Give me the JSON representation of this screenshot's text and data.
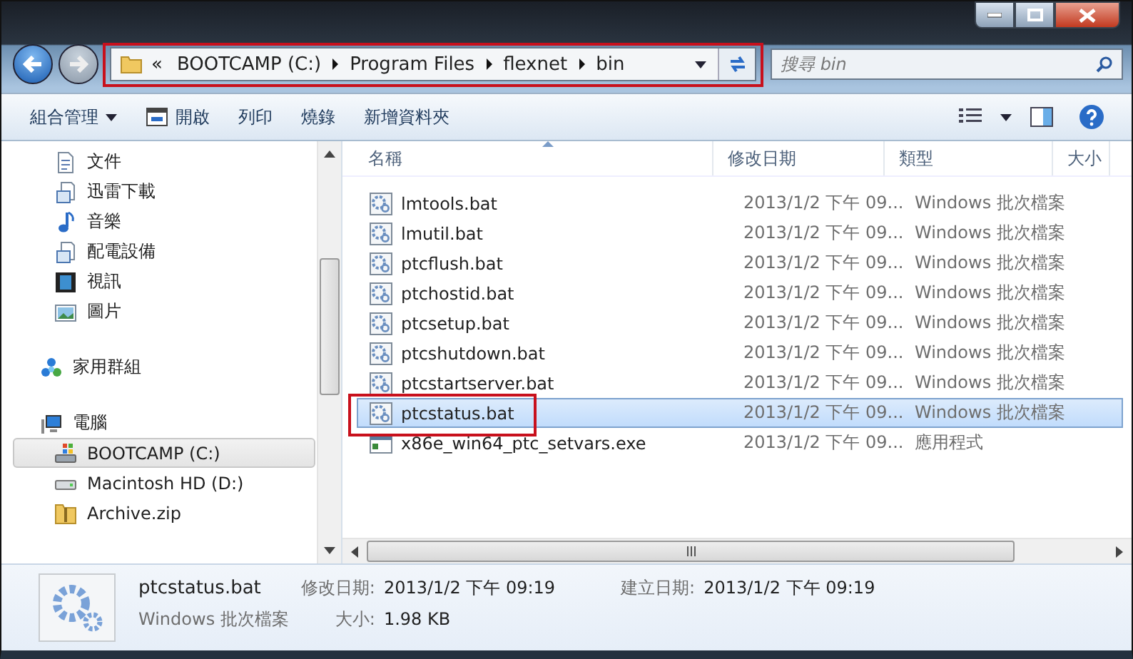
{
  "window_controls": [
    {
      "kind": "minimize"
    },
    {
      "kind": "maximize"
    },
    {
      "kind": "close"
    }
  ],
  "address_bar": {
    "overflow": "«",
    "segments": [
      "BOOTCAMP (C:)",
      "Program Files",
      "flexnet",
      "bin"
    ]
  },
  "search": {
    "placeholder": "搜尋 bin"
  },
  "toolbar": [
    {
      "label": "組合管理",
      "kind": "menu"
    },
    {
      "label": "開啟",
      "kind": "open"
    },
    {
      "label": "列印",
      "kind": "plain"
    },
    {
      "label": "燒錄",
      "kind": "plain"
    },
    {
      "label": "新增資料夾",
      "kind": "plain"
    }
  ],
  "sidebar": {
    "groups": [
      {
        "children": [
          {
            "label": "文件",
            "kind": "document",
            "selected": false
          },
          {
            "label": "迅雷下載",
            "kind": "download",
            "selected": false
          },
          {
            "label": "音樂",
            "kind": "music",
            "selected": false
          },
          {
            "label": "配電設備",
            "kind": "download",
            "selected": false
          },
          {
            "label": "視訊",
            "kind": "video",
            "selected": false
          },
          {
            "label": "圖片",
            "kind": "picture",
            "selected": false
          }
        ]
      },
      {
        "label": "家用群組",
        "kind": "homegroup",
        "selected": false
      },
      {
        "label": "電腦",
        "kind": "computer",
        "selected": false,
        "children": [
          {
            "label": "BOOTCAMP (C:)",
            "kind": "windows-drive",
            "selected": true
          },
          {
            "label": "Macintosh HD (D:)",
            "kind": "drive",
            "selected": false
          },
          {
            "label": "Archive.zip",
            "kind": "zip",
            "selected": false
          }
        ]
      }
    ]
  },
  "table": {
    "columns": [
      "名稱",
      "修改日期",
      "類型",
      "大小"
    ],
    "rows": [
      {
        "name": "lmtools.bat",
        "date": "2013/1/2 下午 09...",
        "type": "Windows 批次檔案",
        "kind": "bat",
        "selected": false
      },
      {
        "name": "lmutil.bat",
        "date": "2013/1/2 下午 09...",
        "type": "Windows 批次檔案",
        "kind": "bat",
        "selected": false
      },
      {
        "name": "ptcflush.bat",
        "date": "2013/1/2 下午 09...",
        "type": "Windows 批次檔案",
        "kind": "bat",
        "selected": false
      },
      {
        "name": "ptchostid.bat",
        "date": "2013/1/2 下午 09...",
        "type": "Windows 批次檔案",
        "kind": "bat",
        "selected": false
      },
      {
        "name": "ptcsetup.bat",
        "date": "2013/1/2 下午 09...",
        "type": "Windows 批次檔案",
        "kind": "bat",
        "selected": false
      },
      {
        "name": "ptcshutdown.bat",
        "date": "2013/1/2 下午 09...",
        "type": "Windows 批次檔案",
        "kind": "bat",
        "selected": false
      },
      {
        "name": "ptcstartserver.bat",
        "date": "2013/1/2 下午 09...",
        "type": "Windows 批次檔案",
        "kind": "bat",
        "selected": false
      },
      {
        "name": "ptcstatus.bat",
        "date": "2013/1/2 下午 09...",
        "type": "Windows 批次檔案",
        "kind": "bat",
        "selected": true
      },
      {
        "name": "x86e_win64_ptc_setvars.exe",
        "date": "2013/1/2 下午 09...",
        "type": "應用程式",
        "kind": "exe",
        "selected": false
      }
    ]
  },
  "details": {
    "name": "ptcstatus.bat",
    "type": "Windows 批次檔案",
    "fields": [
      {
        "label": "修改日期:",
        "value": "2013/1/2 下午 09:19"
      },
      {
        "label": "建立日期:",
        "value": "2013/1/2 下午 09:19"
      },
      {
        "label": "大小:",
        "value": "1.98 KB"
      }
    ]
  }
}
